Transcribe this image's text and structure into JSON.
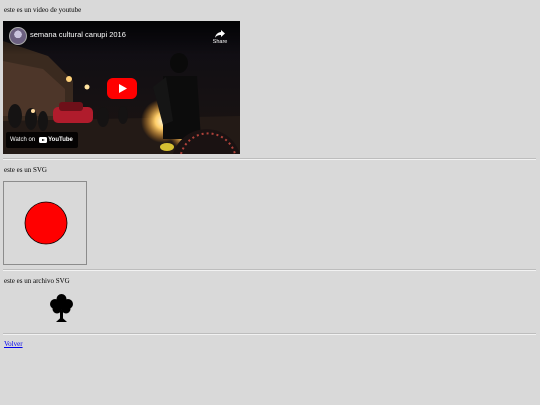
{
  "captions": {
    "video": "este es un video de youtube",
    "svg": "este es un SVG",
    "svg_file": "este es un archivo SVG"
  },
  "video": {
    "title": "semana cultural canupi 2016",
    "share_label": "Share",
    "watch_on": "Watch on",
    "youtube_brand": "YouTube",
    "play_color": "#ff0000"
  },
  "svg_circle": {
    "fill": "#ff0000",
    "stroke": "#000000"
  },
  "tree_icon": "tree-icon",
  "back_link": "Volver"
}
